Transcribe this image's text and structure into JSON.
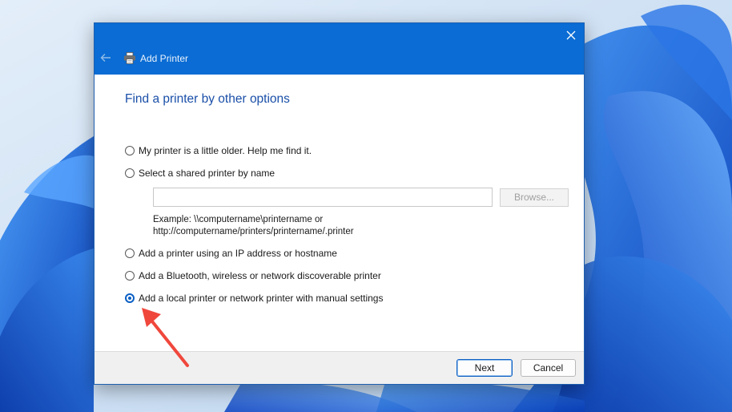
{
  "window": {
    "title": "Add Printer",
    "close_icon": "close-icon",
    "back_icon": "back-arrow-icon",
    "app_icon": "printer-icon"
  },
  "page": {
    "heading": "Find a printer by other options"
  },
  "options": [
    {
      "label": "My printer is a little older. Help me find it.",
      "checked": false
    },
    {
      "label": "Select a shared printer by name",
      "checked": false
    },
    {
      "label": "Add a printer using an IP address or hostname",
      "checked": false
    },
    {
      "label": "Add a Bluetooth, wireless or network discoverable printer",
      "checked": false
    },
    {
      "label": "Add a local printer or network printer with manual settings",
      "checked": true
    }
  ],
  "shared_printer": {
    "value": "",
    "browse_label": "Browse...",
    "example_line1": "Example: \\\\computername\\printername or",
    "example_line2": "http://computername/printers/printername/.printer"
  },
  "footer": {
    "next_label": "Next",
    "cancel_label": "Cancel"
  },
  "colors": {
    "titlebar": "#0a6cd4",
    "heading": "#1a4fa8",
    "accent": "#0a5fc4",
    "annotation_arrow": "#f0473c"
  }
}
